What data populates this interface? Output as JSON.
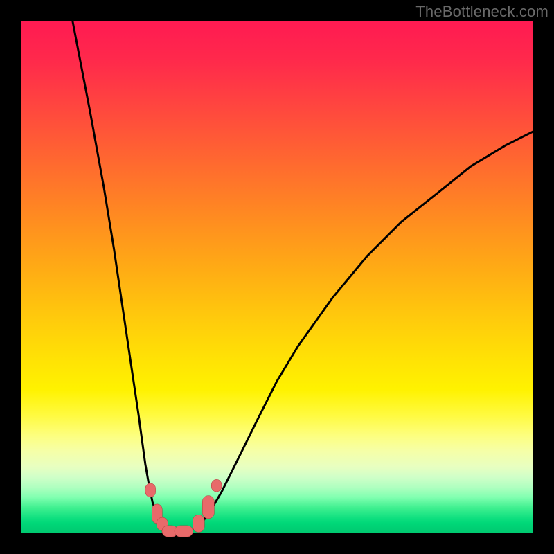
{
  "attribution": "TheBottleneck.com",
  "colors": {
    "frame": "#000000",
    "curve": "#000000",
    "marker_fill": "#e86a6a",
    "marker_stroke": "#b03838",
    "attribution_text": "#6a6a6a"
  },
  "chart_data": {
    "type": "line",
    "title": "",
    "xlabel": "",
    "ylabel": "",
    "xlim": [
      0,
      100
    ],
    "ylim": [
      0,
      100
    ],
    "grid": false,
    "legend": false,
    "note": "Axes are unlabeled in the source image; x and y are normalized 0–100. y ≈ 0 indicates optimal (green), y → 100 indicates worst (red). Values estimated from pixel positions.",
    "series": [
      {
        "name": "left-branch",
        "x": [
          10.1,
          13.5,
          16.2,
          18.2,
          19.6,
          21.6,
          23.0,
          24.3,
          25.0,
          25.7,
          26.4,
          27.0,
          27.7
        ],
        "y": [
          100.0,
          82.4,
          67.6,
          55.4,
          45.9,
          32.4,
          23.0,
          13.5,
          9.5,
          6.1,
          4.1,
          2.7,
          1.4
        ]
      },
      {
        "name": "valley",
        "x": [
          27.7,
          28.4,
          29.1,
          29.7,
          30.4,
          31.1,
          31.8,
          32.4,
          33.1,
          33.8,
          34.5
        ],
        "y": [
          1.4,
          0.9,
          0.5,
          0.3,
          0.3,
          0.3,
          0.4,
          0.5,
          0.7,
          1.0,
          1.4
        ]
      },
      {
        "name": "right-branch",
        "x": [
          34.5,
          35.8,
          37.2,
          39.2,
          41.9,
          45.9,
          50.0,
          54.1,
          60.8,
          67.6,
          74.3,
          81.1,
          87.8,
          94.6,
          100.0
        ],
        "y": [
          1.4,
          2.7,
          4.7,
          8.1,
          13.5,
          21.6,
          29.7,
          36.5,
          45.9,
          54.1,
          60.8,
          66.2,
          71.6,
          75.7,
          78.4
        ]
      }
    ],
    "markers": {
      "name": "highlighted-points",
      "shape_note": "Rounded-rectangle / pill shaped markers near the valley floor.",
      "points": [
        {
          "x": 25.3,
          "y": 8.4,
          "w": 2.0,
          "h": 2.7
        },
        {
          "x": 26.6,
          "y": 3.8,
          "w": 2.0,
          "h": 3.8
        },
        {
          "x": 27.6,
          "y": 1.8,
          "w": 2.2,
          "h": 2.6
        },
        {
          "x": 29.1,
          "y": 0.4,
          "w": 3.1,
          "h": 2.2
        },
        {
          "x": 31.8,
          "y": 0.4,
          "w": 3.6,
          "h": 2.2
        },
        {
          "x": 34.7,
          "y": 1.9,
          "w": 2.3,
          "h": 3.4
        },
        {
          "x": 36.6,
          "y": 5.1,
          "w": 2.3,
          "h": 4.5
        },
        {
          "x": 38.2,
          "y": 9.3,
          "w": 2.0,
          "h": 2.4
        }
      ]
    }
  }
}
